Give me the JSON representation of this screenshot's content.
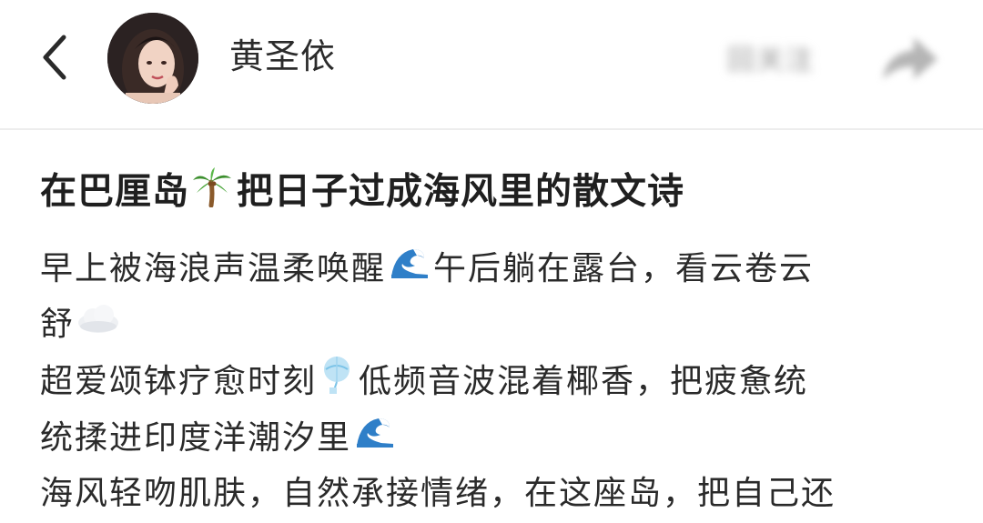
{
  "header": {
    "username": "黄圣依",
    "follow_label": "回关注"
  },
  "post": {
    "title": "在巴厘岛",
    "title_emoji": "palm-tree-icon",
    "title_rest": "把日子过成海风里的散文诗",
    "lines": [
      {
        "text": "早上被海浪声温柔唤醒",
        "emoji": "wave-icon",
        "after": "午后躺在露台，看云卷云"
      },
      {
        "text": "舒",
        "emoji": "cloud-icon",
        "after": ""
      },
      {
        "text": "超爱颂钵疗愈时刻",
        "emoji": "wind-chime-icon",
        "after": "低频音波混着椰香，把疲惫统"
      },
      {
        "text": "统揉进印度洋潮汐里",
        "emoji": "wave-icon",
        "after": ""
      },
      {
        "text": "海风轻吻肌肤，自然承接情绪，在这座岛，把自己还",
        "emoji": "",
        "after": ""
      }
    ]
  },
  "colors": {
    "text": "#2a2a2a",
    "title": "#1f1f1f",
    "divider": "#ededed",
    "wave": "#2f7fc8",
    "palm": "#3c8f2e"
  }
}
